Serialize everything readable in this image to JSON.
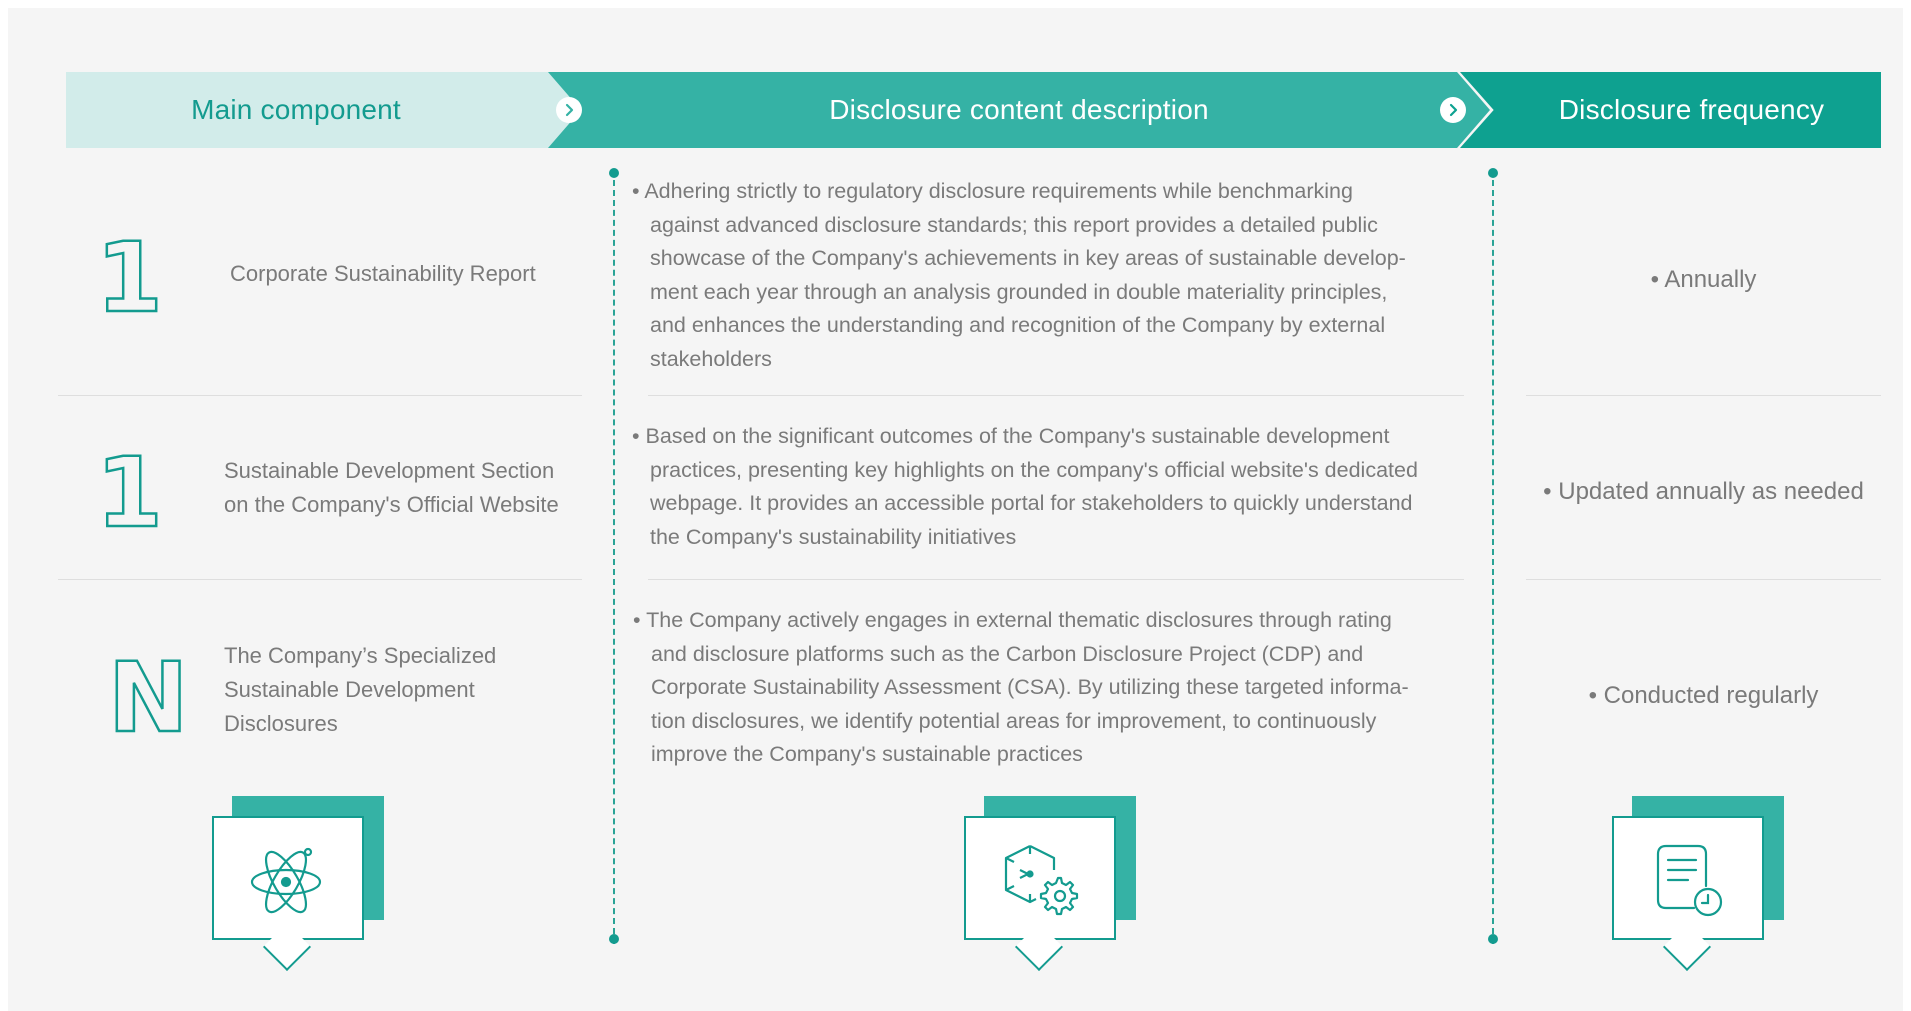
{
  "header": {
    "main_component": "Main component",
    "content_description": "Disclosure content description",
    "frequency": "Disclosure frequency"
  },
  "rows": [
    {
      "glyph": "1",
      "component": "Corporate Sustainability Report",
      "description_lines": [
        "• Adhering strictly to regulatory disclosure requirements while benchmarking",
        "against advanced disclosure standards; this report provides a detailed public",
        "showcase of the Company's achievements in key areas of sustainable develop-",
        "ment each year through an analysis grounded in double materiality principles,",
        "and enhances the understanding and recognition of the Company by external",
        "stakeholders"
      ],
      "frequency": "• Annually"
    },
    {
      "glyph": "1",
      "component_lines": [
        "Sustainable Development Section",
        "on the Company's Official Website"
      ],
      "description_lines": [
        "• Based on the significant outcomes of the Company's sustainable development",
        "practices, presenting key highlights on the company's official website's dedicated",
        "webpage. It provides an accessible portal for stakeholders to quickly understand",
        "the Company's sustainability initiatives"
      ],
      "frequency": "• Updated annually as needed"
    },
    {
      "glyph": "N",
      "component_lines": [
        "The Company’s Specialized",
        "Sustainable Development",
        "Disclosures"
      ],
      "description_lines": [
        "• The Company actively engages in external thematic disclosures through rating",
        "and disclosure platforms such as the Carbon Disclosure Project (CDP) and",
        "Corporate Sustainability Assessment (CSA). By utilizing these targeted informa-",
        "tion disclosures, we identify potential areas for improvement, to continuously",
        "improve the Company's sustainable practices"
      ],
      "frequency": "• Conducted regularly"
    }
  ],
  "icons": [
    "atom-icon",
    "cube-gear-icon",
    "document-clock-icon"
  ],
  "colors": {
    "teal_dark": "#139b8f",
    "teal_mid": "#35b2a5",
    "teal_light": "#d2ecea",
    "text": "#7a7a7a",
    "panel": "#f5f5f5"
  }
}
